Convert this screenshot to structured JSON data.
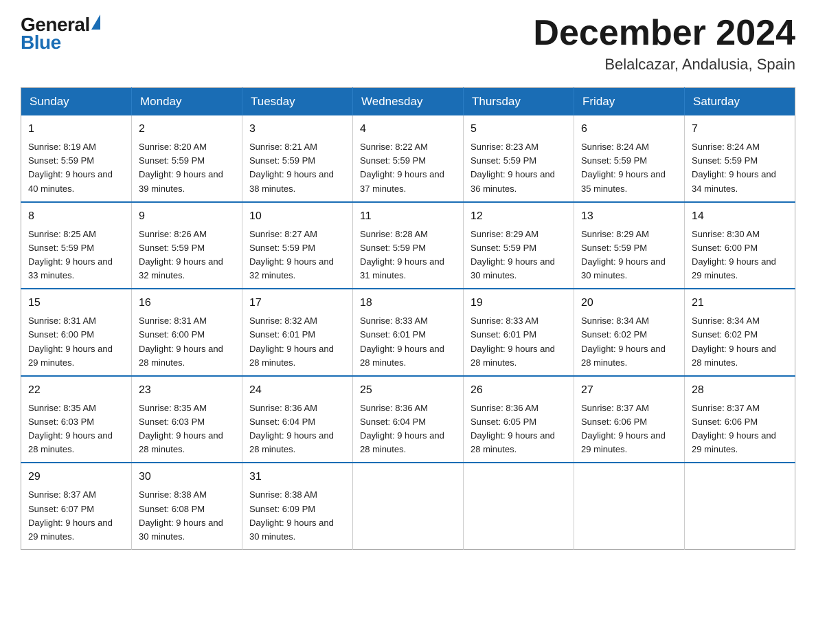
{
  "logo": {
    "general": "General",
    "blue": "Blue",
    "triangle": "▲"
  },
  "title": "December 2024",
  "location": "Belalcazar, Andalusia, Spain",
  "weekdays": [
    "Sunday",
    "Monday",
    "Tuesday",
    "Wednesday",
    "Thursday",
    "Friday",
    "Saturday"
  ],
  "weeks": [
    [
      {
        "day": "1",
        "sunrise": "8:19 AM",
        "sunset": "5:59 PM",
        "daylight": "9 hours and 40 minutes."
      },
      {
        "day": "2",
        "sunrise": "8:20 AM",
        "sunset": "5:59 PM",
        "daylight": "9 hours and 39 minutes."
      },
      {
        "day": "3",
        "sunrise": "8:21 AM",
        "sunset": "5:59 PM",
        "daylight": "9 hours and 38 minutes."
      },
      {
        "day": "4",
        "sunrise": "8:22 AM",
        "sunset": "5:59 PM",
        "daylight": "9 hours and 37 minutes."
      },
      {
        "day": "5",
        "sunrise": "8:23 AM",
        "sunset": "5:59 PM",
        "daylight": "9 hours and 36 minutes."
      },
      {
        "day": "6",
        "sunrise": "8:24 AM",
        "sunset": "5:59 PM",
        "daylight": "9 hours and 35 minutes."
      },
      {
        "day": "7",
        "sunrise": "8:24 AM",
        "sunset": "5:59 PM",
        "daylight": "9 hours and 34 minutes."
      }
    ],
    [
      {
        "day": "8",
        "sunrise": "8:25 AM",
        "sunset": "5:59 PM",
        "daylight": "9 hours and 33 minutes."
      },
      {
        "day": "9",
        "sunrise": "8:26 AM",
        "sunset": "5:59 PM",
        "daylight": "9 hours and 32 minutes."
      },
      {
        "day": "10",
        "sunrise": "8:27 AM",
        "sunset": "5:59 PM",
        "daylight": "9 hours and 32 minutes."
      },
      {
        "day": "11",
        "sunrise": "8:28 AM",
        "sunset": "5:59 PM",
        "daylight": "9 hours and 31 minutes."
      },
      {
        "day": "12",
        "sunrise": "8:29 AM",
        "sunset": "5:59 PM",
        "daylight": "9 hours and 30 minutes."
      },
      {
        "day": "13",
        "sunrise": "8:29 AM",
        "sunset": "5:59 PM",
        "daylight": "9 hours and 30 minutes."
      },
      {
        "day": "14",
        "sunrise": "8:30 AM",
        "sunset": "6:00 PM",
        "daylight": "9 hours and 29 minutes."
      }
    ],
    [
      {
        "day": "15",
        "sunrise": "8:31 AM",
        "sunset": "6:00 PM",
        "daylight": "9 hours and 29 minutes."
      },
      {
        "day": "16",
        "sunrise": "8:31 AM",
        "sunset": "6:00 PM",
        "daylight": "9 hours and 28 minutes."
      },
      {
        "day": "17",
        "sunrise": "8:32 AM",
        "sunset": "6:01 PM",
        "daylight": "9 hours and 28 minutes."
      },
      {
        "day": "18",
        "sunrise": "8:33 AM",
        "sunset": "6:01 PM",
        "daylight": "9 hours and 28 minutes."
      },
      {
        "day": "19",
        "sunrise": "8:33 AM",
        "sunset": "6:01 PM",
        "daylight": "9 hours and 28 minutes."
      },
      {
        "day": "20",
        "sunrise": "8:34 AM",
        "sunset": "6:02 PM",
        "daylight": "9 hours and 28 minutes."
      },
      {
        "day": "21",
        "sunrise": "8:34 AM",
        "sunset": "6:02 PM",
        "daylight": "9 hours and 28 minutes."
      }
    ],
    [
      {
        "day": "22",
        "sunrise": "8:35 AM",
        "sunset": "6:03 PM",
        "daylight": "9 hours and 28 minutes."
      },
      {
        "day": "23",
        "sunrise": "8:35 AM",
        "sunset": "6:03 PM",
        "daylight": "9 hours and 28 minutes."
      },
      {
        "day": "24",
        "sunrise": "8:36 AM",
        "sunset": "6:04 PM",
        "daylight": "9 hours and 28 minutes."
      },
      {
        "day": "25",
        "sunrise": "8:36 AM",
        "sunset": "6:04 PM",
        "daylight": "9 hours and 28 minutes."
      },
      {
        "day": "26",
        "sunrise": "8:36 AM",
        "sunset": "6:05 PM",
        "daylight": "9 hours and 28 minutes."
      },
      {
        "day": "27",
        "sunrise": "8:37 AM",
        "sunset": "6:06 PM",
        "daylight": "9 hours and 29 minutes."
      },
      {
        "day": "28",
        "sunrise": "8:37 AM",
        "sunset": "6:06 PM",
        "daylight": "9 hours and 29 minutes."
      }
    ],
    [
      {
        "day": "29",
        "sunrise": "8:37 AM",
        "sunset": "6:07 PM",
        "daylight": "9 hours and 29 minutes."
      },
      {
        "day": "30",
        "sunrise": "8:38 AM",
        "sunset": "6:08 PM",
        "daylight": "9 hours and 30 minutes."
      },
      {
        "day": "31",
        "sunrise": "8:38 AM",
        "sunset": "6:09 PM",
        "daylight": "9 hours and 30 minutes."
      },
      null,
      null,
      null,
      null
    ]
  ]
}
